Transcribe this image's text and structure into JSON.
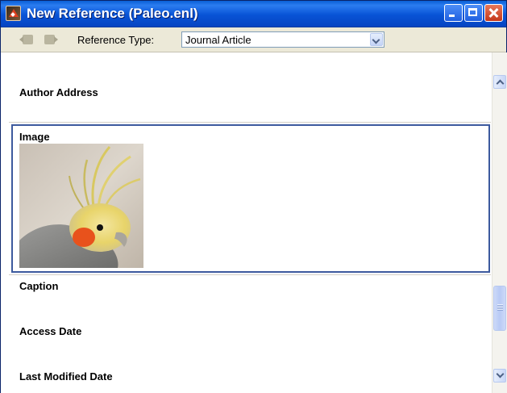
{
  "window": {
    "title": "New Reference (Paleo.enl)"
  },
  "toolbar": {
    "reference_type_label": "Reference Type:",
    "reference_type_value": "Journal Article",
    "icons": [
      "prev-reference-icon",
      "next-reference-icon"
    ]
  },
  "fields": [
    {
      "label": "Author Address",
      "value": ""
    },
    {
      "label": "Image",
      "value": "",
      "image": "cockatiel-photo"
    },
    {
      "label": "Caption",
      "value": ""
    },
    {
      "label": "Access Date",
      "value": ""
    },
    {
      "label": "Last Modified Date",
      "value": ""
    }
  ],
  "colors": {
    "titlebar": "#0853d6",
    "selection_border": "#3d5a9e",
    "window_bg": "#ece9d8"
  }
}
